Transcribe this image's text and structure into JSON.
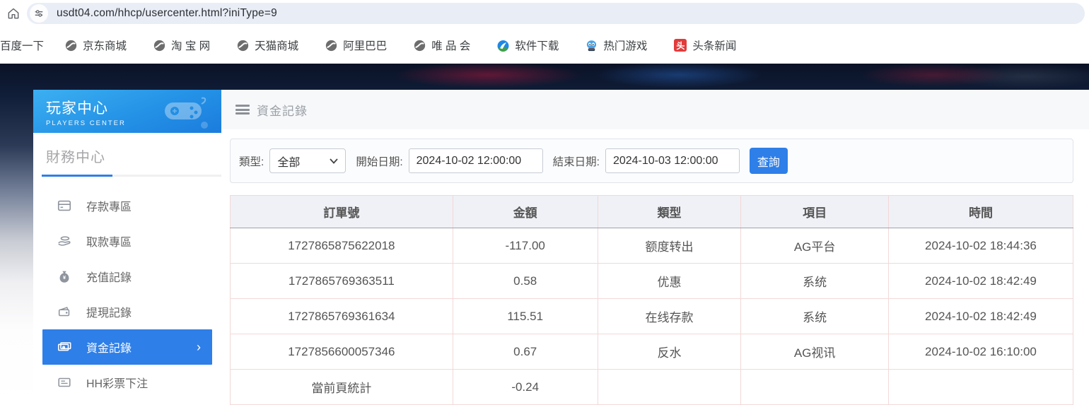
{
  "browser": {
    "url": "usdt04.com/hhcp/usercenter.html?iniType=9",
    "bookmarks": [
      {
        "label": "百度一下",
        "icon": "none"
      },
      {
        "label": "京东商城",
        "icon": "globe"
      },
      {
        "label": "淘 宝 网",
        "icon": "globe"
      },
      {
        "label": "天猫商城",
        "icon": "globe"
      },
      {
        "label": "阿里巴巴",
        "icon": "globe"
      },
      {
        "label": "唯 品 会",
        "icon": "globe"
      },
      {
        "label": "软件下载",
        "icon": "software"
      },
      {
        "label": "热门游戏",
        "icon": "game-mascot"
      },
      {
        "label": "头条新闻",
        "icon": "toutiao",
        "badge_char": "头"
      }
    ]
  },
  "sidebar": {
    "title": "玩家中心",
    "subtitle": "PLAYERS CENTER",
    "section_title": "財務中心",
    "items": [
      {
        "label": "存款專區",
        "icon": "deposit-card-icon",
        "selected": false
      },
      {
        "label": "取款專區",
        "icon": "withdraw-hand-icon",
        "selected": false
      },
      {
        "label": "充值記錄",
        "icon": "moneybag-icon",
        "selected": false
      },
      {
        "label": "提現記錄",
        "icon": "wallet-icon",
        "selected": false
      },
      {
        "label": "資金記錄",
        "icon": "banknotes-icon",
        "selected": true,
        "chevron": "›"
      },
      {
        "label": "HH彩票下注",
        "icon": "ticket-icon",
        "selected": false
      }
    ]
  },
  "main": {
    "title": "資金記錄"
  },
  "filters": {
    "type_label": "類型:",
    "type_value": "全部",
    "start_label": "開始日期:",
    "start_value": "2024-10-02 12:00:00",
    "end_label": "結束日期:",
    "end_value": "2024-10-03 12:00:00",
    "search_label": "查詢"
  },
  "table": {
    "headers": [
      "訂單號",
      "金額",
      "類型",
      "項目",
      "時間"
    ],
    "rows": [
      [
        "1727865875622018",
        "-117.00",
        "额度转出",
        "AG平台",
        "2024-10-02 18:44:36"
      ],
      [
        "1727865769363511",
        "0.58",
        "优惠",
        "系统",
        "2024-10-02 18:42:49"
      ],
      [
        "1727865769361634",
        "115.51",
        "在线存款",
        "系统",
        "2024-10-02 18:42:49"
      ],
      [
        "1727856600057346",
        "0.67",
        "反水",
        "AG视讯",
        "2024-10-02 16:10:00"
      ],
      [
        "當前頁統計",
        "-0.24",
        "",
        "",
        ""
      ]
    ]
  },
  "colors": {
    "accent_blue": "#2e7fe8",
    "sidebar_gradient_top": "#3cb0f2",
    "sidebar_gradient_bottom": "#1b7cdd",
    "table_border_pink": "#f3d8d8",
    "header_bg": "#eff1f6",
    "toutiao_red": "#e23b3b"
  }
}
